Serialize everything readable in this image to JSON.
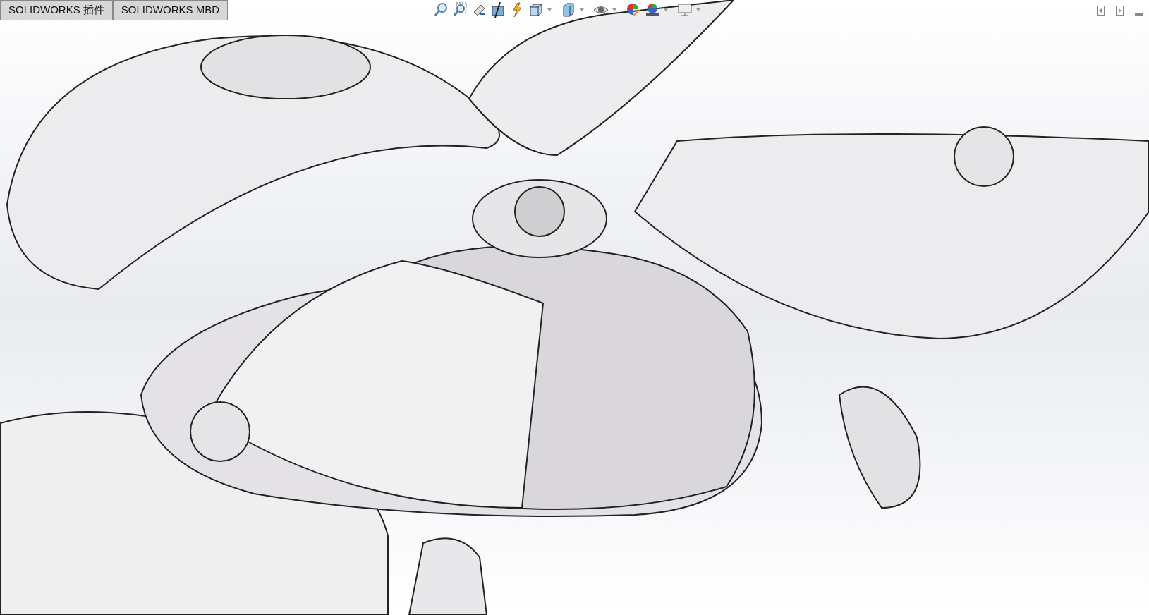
{
  "tabs": [
    {
      "label": "SOLIDWORKS 插件",
      "selected": false
    },
    {
      "label": "SOLIDWORKS MBD",
      "selected": false
    }
  ]
}
